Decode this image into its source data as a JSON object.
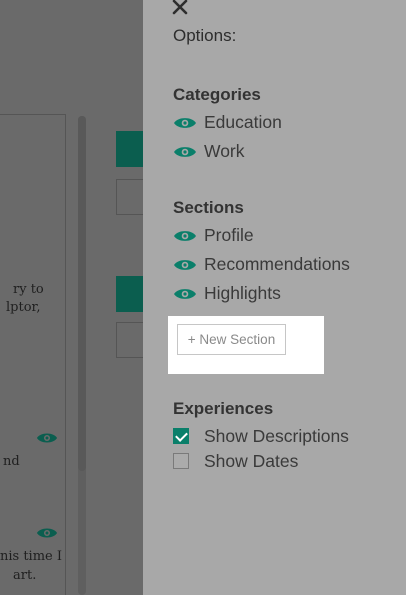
{
  "background": {
    "text_fragments": [
      "ry to",
      "lptor,",
      "nd",
      "nis time I",
      "art."
    ]
  },
  "options": {
    "title": "Options:",
    "categories": {
      "heading": "Categories",
      "items": [
        {
          "label": "Education",
          "icon": "eye-icon"
        },
        {
          "label": "Work",
          "icon": "eye-icon"
        }
      ]
    },
    "sections": {
      "heading": "Sections",
      "items": [
        {
          "label": "Profile",
          "icon": "eye-icon"
        },
        {
          "label": "Recommendations",
          "icon": "eye-icon"
        },
        {
          "label": "Highlights",
          "icon": "eye-icon"
        }
      ],
      "new_section_label": "+ New Section"
    },
    "experiences": {
      "heading": "Experiences",
      "items": [
        {
          "label": "Show Descriptions",
          "checked": true
        },
        {
          "label": "Show Dates",
          "checked": false
        }
      ]
    }
  },
  "colors": {
    "accent": "#0a7f6a",
    "panel_bg": "#a8a8a8",
    "overlay_bg": "#6a6a6a"
  }
}
